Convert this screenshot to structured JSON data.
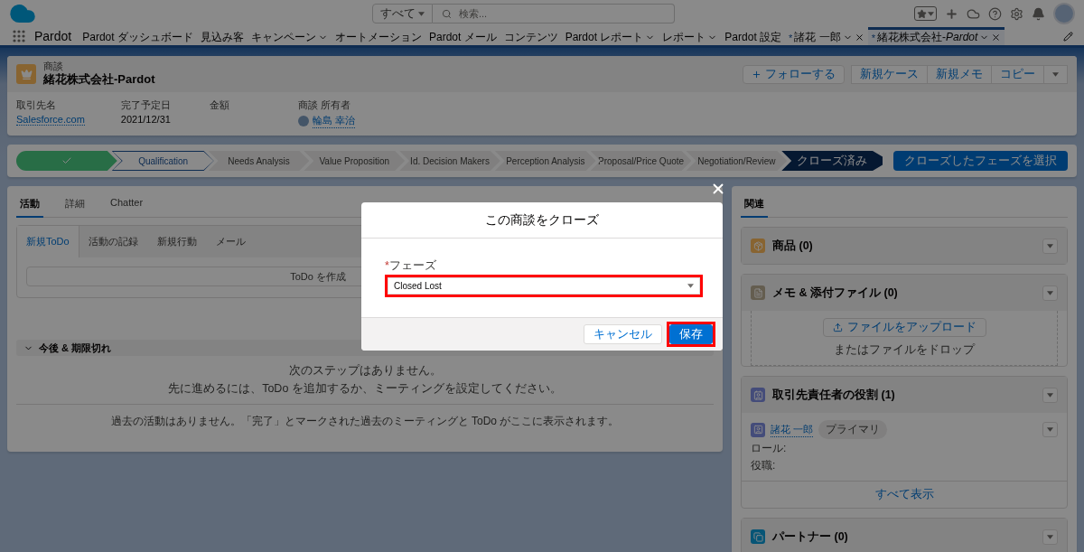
{
  "header": {
    "search_scope": "すべて",
    "search_placeholder": "検索..."
  },
  "nav": {
    "app_name": "Pardot",
    "tabs": [
      {
        "label": "Pardot ダッシュボード",
        "menu": false,
        "closable": false,
        "selected": false
      },
      {
        "label": "見込み客",
        "menu": false,
        "closable": false,
        "selected": false
      },
      {
        "label": "キャンペーン",
        "menu": true,
        "closable": false,
        "selected": false
      },
      {
        "label": "オートメーション",
        "menu": false,
        "closable": false,
        "selected": false
      },
      {
        "label": "Pardot メール",
        "menu": false,
        "closable": false,
        "selected": false
      },
      {
        "label": "コンテンツ",
        "menu": false,
        "closable": false,
        "selected": false
      },
      {
        "label": "Pardot レポート",
        "menu": true,
        "closable": false,
        "selected": false
      },
      {
        "label": "レポート",
        "menu": true,
        "closable": false,
        "selected": false
      },
      {
        "label": "Pardot 設定",
        "menu": false,
        "closable": false,
        "selected": false
      },
      {
        "prefix": "*",
        "label": "諸花 一郎",
        "menu": true,
        "closable": true,
        "selected": false
      },
      {
        "prefix": "*",
        "label": "緒花株式会社-*Pardot*",
        "menu": true,
        "closable": true,
        "selected": true
      }
    ]
  },
  "record": {
    "object_type": "商談",
    "title": "緒花株式会社-Pardot",
    "actions": [
      "フォローする",
      "新規ケース",
      "新規メモ",
      "コピー"
    ],
    "fields": [
      {
        "label": "取引先名",
        "value": "Salesforce.com",
        "kind": "link"
      },
      {
        "label": "完了予定日",
        "value": "2021/12/31",
        "kind": "text"
      },
      {
        "label": "金額",
        "kind": "empty"
      },
      {
        "label": "商談 所有者",
        "value": "輪島 幸治",
        "kind": "user"
      }
    ]
  },
  "path": {
    "stages": [
      {
        "kind": "complete"
      },
      {
        "label": "Qualification",
        "kind": "current"
      },
      {
        "label": "Needs Analysis",
        "kind": "incomplete"
      },
      {
        "label": "Value Proposition",
        "kind": "incomplete"
      },
      {
        "label": "Id. Decision Makers",
        "kind": "incomplete"
      },
      {
        "label": "Perception Analysis",
        "kind": "incomplete"
      },
      {
        "label": "Proposal/Price Quote",
        "kind": "incomplete"
      },
      {
        "label": "Negotiation/Review",
        "kind": "incomplete"
      },
      {
        "label": "クローズ済み",
        "kind": "closed"
      }
    ],
    "button": "クローズしたフェーズを選択"
  },
  "activity": {
    "tabs": [
      {
        "label": "活動",
        "selected": true
      },
      {
        "label": "詳細",
        "selected": false
      },
      {
        "label": "Chatter",
        "selected": false
      }
    ],
    "composer_tabs": [
      {
        "label": "新規ToDo",
        "selected": true
      },
      {
        "label": "活動の記録",
        "selected": false
      },
      {
        "label": "新規行動",
        "selected": false
      },
      {
        "label": "メール",
        "selected": false
      }
    ],
    "composer_button": "ToDo を作成",
    "section": "今後 & 期限切れ",
    "empty_lines": [
      "次のステップはありません。",
      "先に進めるには、ToDo を追加するか、ミーティングを設定してください。"
    ],
    "past": "過去の活動はありません。「完了」とマークされた過去のミーティングと ToDo がここに表示されます。"
  },
  "related": {
    "tab": "関連",
    "cards": [
      {
        "kind": "products",
        "title": "商品",
        "count": "(0)"
      },
      {
        "kind": "files",
        "title": "メモ & 添付ファイル",
        "count": "(0)",
        "upload": "ファイルをアップロード",
        "drop": "またはファイルをドロップ"
      },
      {
        "kind": "contact_roles",
        "title": "取引先責任者の役割",
        "count": "(1)",
        "contact": {
          "name": "諸花 一郎",
          "badge": "プライマリ",
          "fields": [
            "ロール:",
            "役職:"
          ]
        },
        "footer": "すべて表示"
      },
      {
        "kind": "partners",
        "title": "パートナー",
        "count": "(0)"
      }
    ]
  },
  "modal": {
    "title": "この商談をクローズ",
    "field": {
      "label": "フェーズ",
      "required": true,
      "value": "Closed Lost",
      "highlighted": true
    },
    "buttons": [
      {
        "label": "キャンセル",
        "kind": "neutral",
        "highlighted": false
      },
      {
        "label": "保存",
        "kind": "brand",
        "highlighted": true
      }
    ]
  }
}
